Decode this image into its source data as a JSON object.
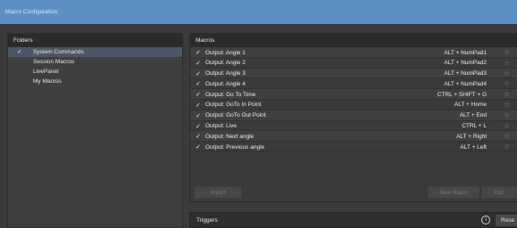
{
  "window": {
    "title": "Macro Configuration"
  },
  "folders": {
    "header": "Folders",
    "items": [
      {
        "label": "System Commands",
        "checked": true,
        "selected": true
      },
      {
        "label": "Session Macros",
        "checked": false,
        "selected": false
      },
      {
        "label": "LivePanel",
        "checked": false,
        "selected": false
      },
      {
        "label": "My Macros",
        "checked": false,
        "selected": false
      }
    ]
  },
  "macros": {
    "header": "Macros",
    "rows": [
      {
        "check": "✓",
        "name": "Output: Angle 1",
        "hotkey": "ALT + NumPad1"
      },
      {
        "check": "✓",
        "name": "Output: Angle 2",
        "hotkey": "ALT + NumPad2"
      },
      {
        "check": "✓",
        "name": "Output: Angle 3",
        "hotkey": "ALT + NumPad3"
      },
      {
        "check": "✓",
        "name": "Output: Angle 4",
        "hotkey": "ALT + NumPad4"
      },
      {
        "check": "✓",
        "name": "Output: Go To Time",
        "hotkey": "CTRL + SHIFT + G"
      },
      {
        "check": "✓",
        "name": "Output: GoTo In Point",
        "hotkey": "ALT + Home"
      },
      {
        "check": "✓",
        "name": "Output: GoTo Out Point",
        "hotkey": "ALT + End"
      },
      {
        "check": "✓",
        "name": "Output: Live",
        "hotkey": "CTRL + L"
      },
      {
        "check": "✓",
        "name": "Output: Next angle",
        "hotkey": "ALT + Right"
      },
      {
        "check": "✓",
        "name": "Output: Previous angle",
        "hotkey": "ALT + Left"
      }
    ],
    "buttons": {
      "import": "Import",
      "new_macro": "New Macro",
      "edit": "Edit"
    }
  },
  "triggers": {
    "header": "Triggers",
    "info_glyph": "i",
    "reset_label": "Rese"
  },
  "icons": {
    "check": "check-icon",
    "star": "star-icon",
    "info": "info-icon"
  },
  "colors": {
    "titlebar": "#5d8fc4",
    "selection": "#4b5766",
    "panel": "#3a3a3a"
  }
}
